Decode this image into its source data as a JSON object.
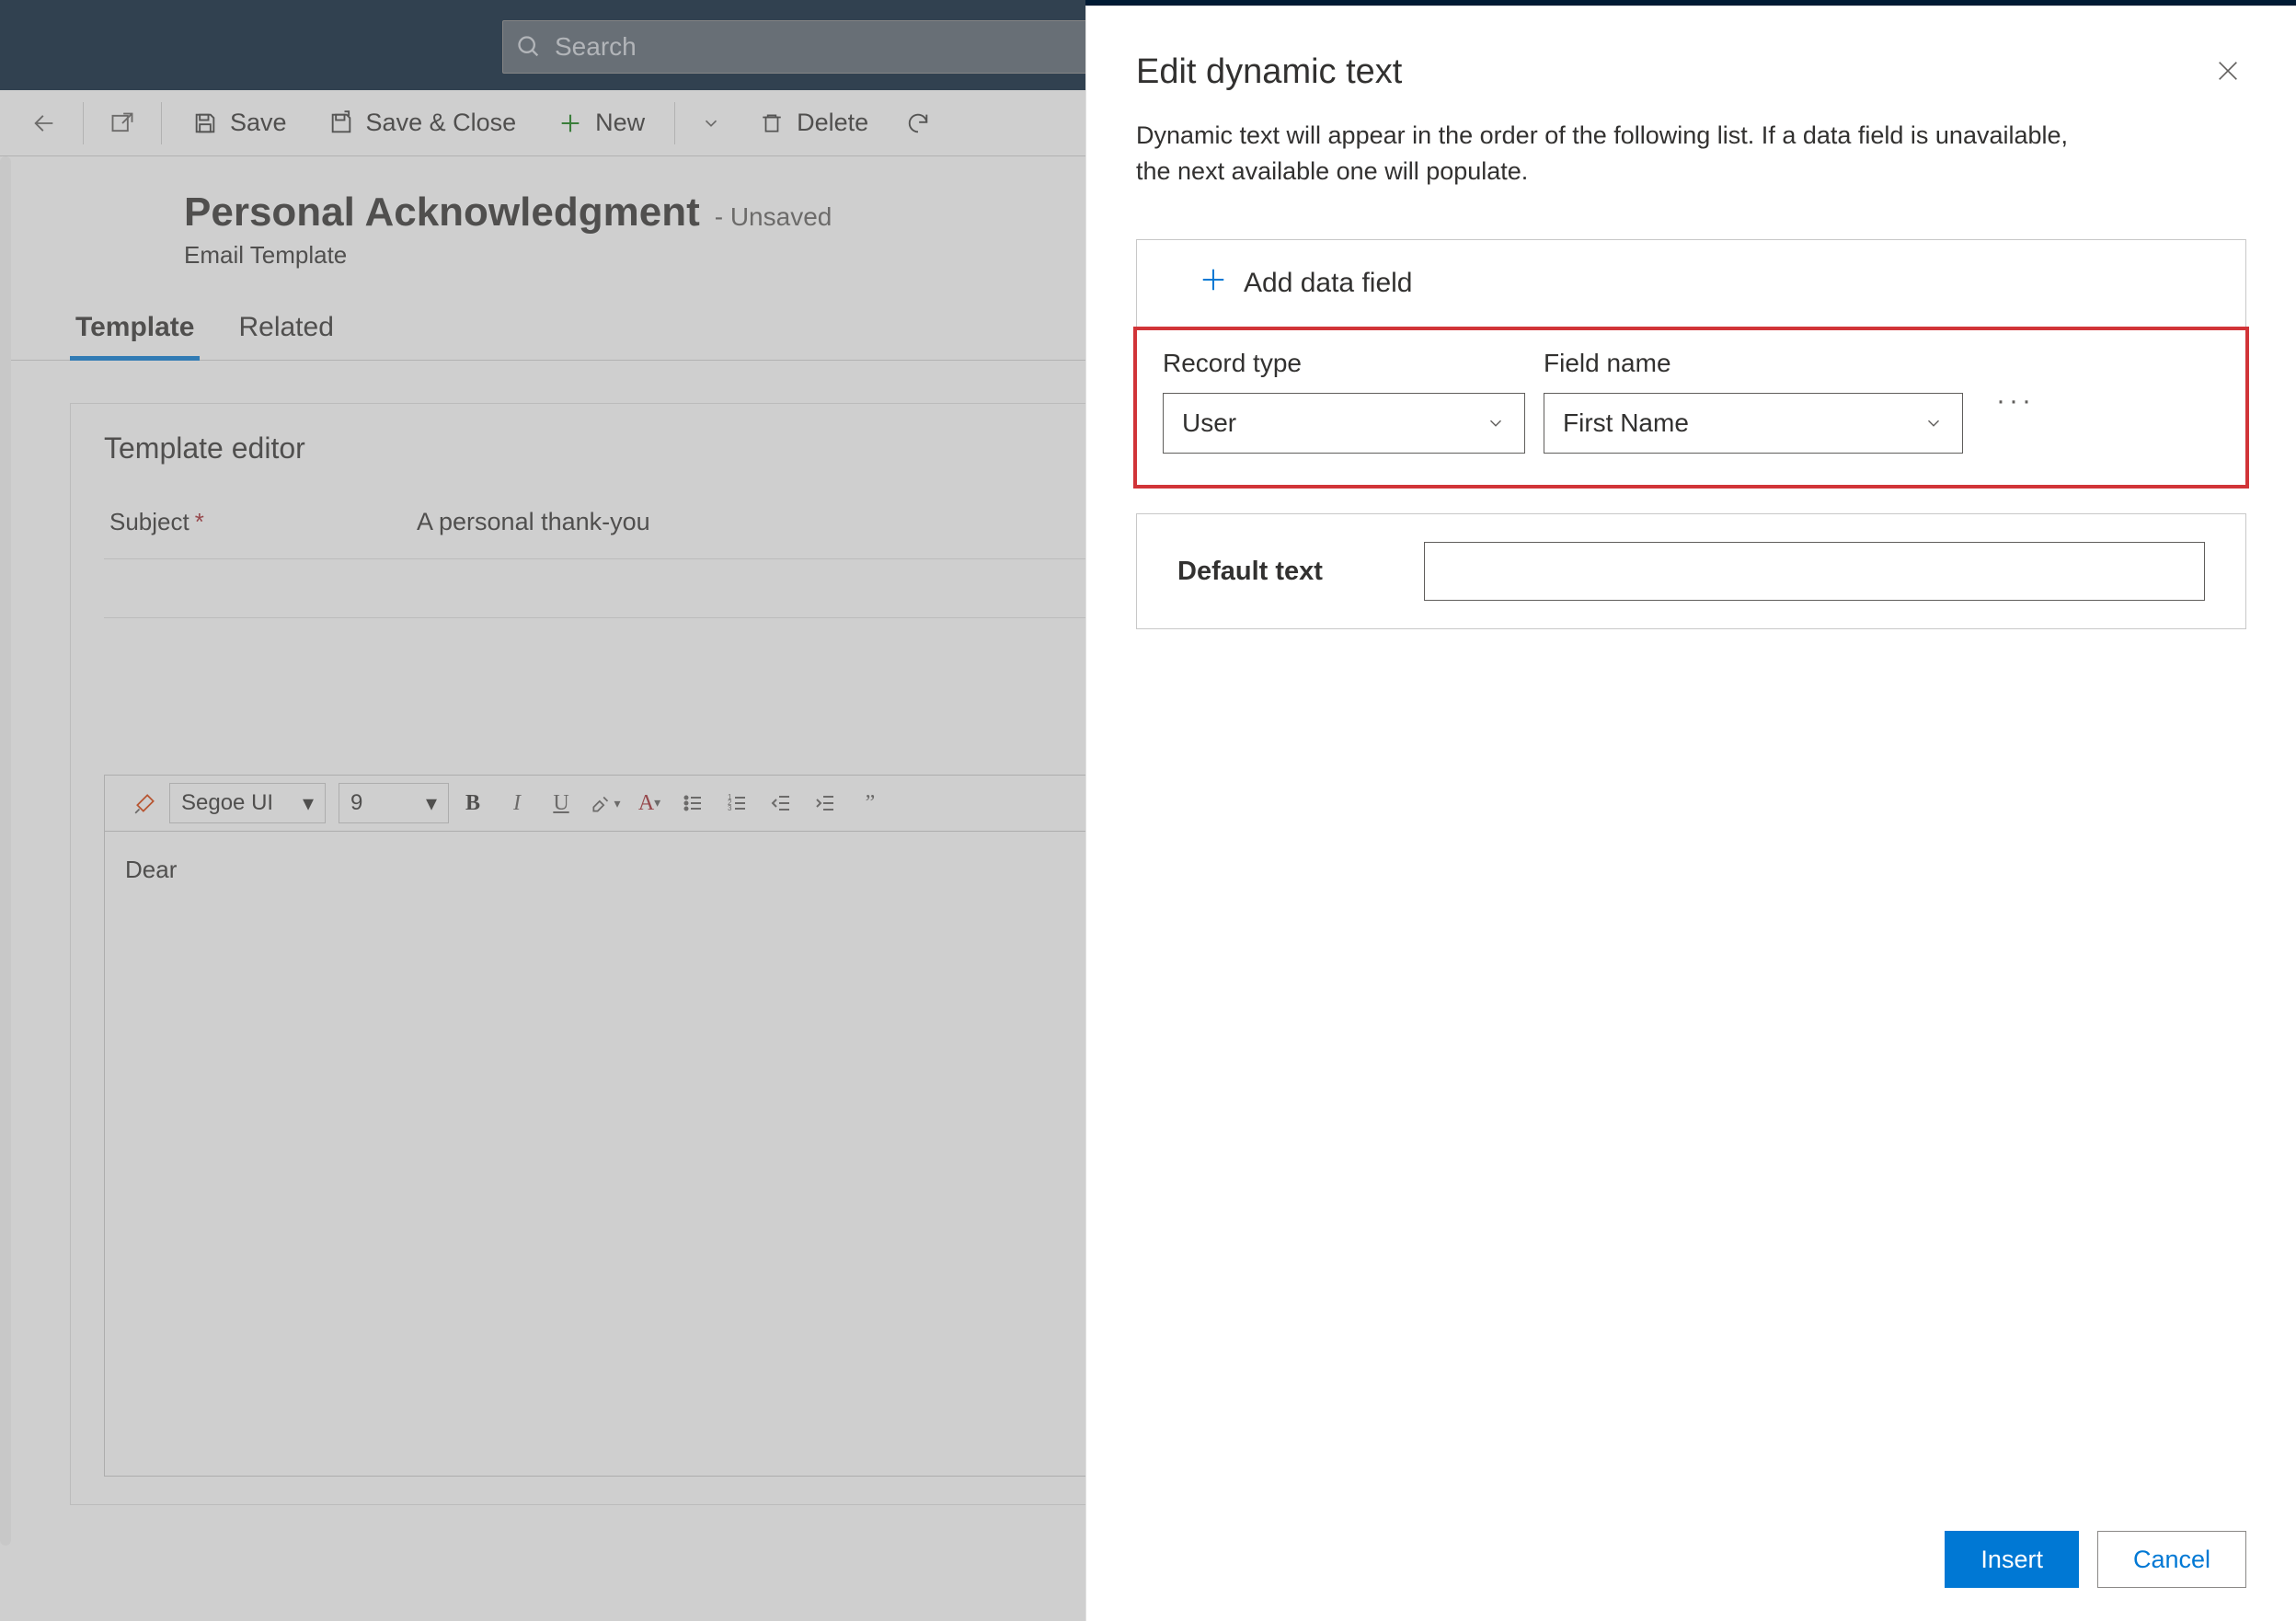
{
  "search": {
    "placeholder": "Search"
  },
  "commandbar": {
    "save": "Save",
    "save_close": "Save & Close",
    "new": "New",
    "delete": "Delete"
  },
  "header": {
    "title": "Personal Acknowledgment",
    "status": "- Unsaved",
    "subtitle": "Email Template"
  },
  "tabs": {
    "template": "Template",
    "related": "Related"
  },
  "editor": {
    "section_title": "Template editor",
    "subject_label": "Subject",
    "subject_value": "A personal thank-you",
    "font_name": "Segoe UI",
    "font_size": "9",
    "body": "Dear"
  },
  "panel": {
    "title": "Edit dynamic text",
    "description": "Dynamic text will appear in the order of the following list. If a data field is unavailable, the next available one will populate.",
    "add_field": "Add data field",
    "record_type_label": "Record type",
    "field_name_label": "Field name",
    "record_type_value": "User",
    "field_name_value": "First Name",
    "default_text_label": "Default text",
    "default_text_value": "",
    "insert": "Insert",
    "cancel": "Cancel"
  }
}
